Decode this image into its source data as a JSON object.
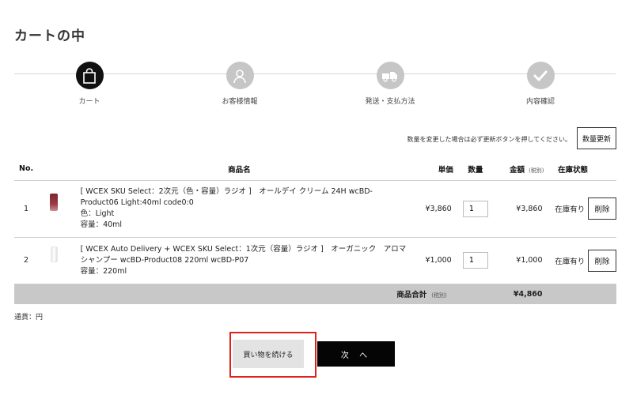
{
  "page": {
    "title": "カートの中"
  },
  "steps": [
    {
      "label": "カート",
      "icon": "shopping-bag-icon",
      "active": true
    },
    {
      "label": "お客様情報",
      "icon": "user-icon",
      "active": false
    },
    {
      "label": "発送・支払方法",
      "icon": "truck-icon",
      "active": false
    },
    {
      "label": "内容確認",
      "icon": "check-icon",
      "active": false
    }
  ],
  "notice": "数量を変更した場合は必ず更新ボタンを押してください。",
  "update_button": "数量更新",
  "table": {
    "headers": {
      "no": "No.",
      "name": "商品名",
      "unit_price": "単価",
      "quantity": "数量",
      "amount": "金額",
      "amount_tax": "(税別)",
      "stock": "在庫状態"
    },
    "rows": [
      {
        "no": "1",
        "name": "[ WCEX SKU Select：2次元（色・容量）ラジオ ]　オールデイ クリーム 24H wcBD-Product06 Light:40ml code0:0",
        "option1": "色：Light",
        "option2": "容量：40ml",
        "unit_price": "¥3,860",
        "quantity": "1",
        "amount": "¥3,860",
        "stock": "在庫有り",
        "delete_label": "削除",
        "thumb": "red-cream-tube"
      },
      {
        "no": "2",
        "name": "[ WCEX Auto Delivery + WCEX SKU Select：1次元（容量）ラジオ ]　オーガニック　アロマシャンプー wcBD-Product08 220ml wcBD-P07",
        "option1": "容量：220ml",
        "unit_price": "¥1,000",
        "quantity": "1",
        "amount": "¥1,000",
        "stock": "在庫有り",
        "delete_label": "削除",
        "thumb": "white-bottle"
      }
    ],
    "total": {
      "label": "商品合計",
      "tax": "(税別)",
      "value": "¥4,860"
    }
  },
  "currency": "通貨：円",
  "buttons": {
    "continue": "買い物を続ける",
    "next": "次 へ"
  },
  "colors": {
    "active_step": "#111111",
    "inactive_step": "#c6c6c6",
    "total_row_bg": "#c8c8c8",
    "highlight": "#e0211b",
    "next_bg": "#050505"
  }
}
